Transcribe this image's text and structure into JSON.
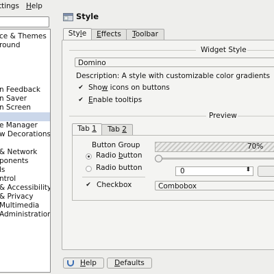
{
  "menubar": {
    "settings_prefix": "ttings",
    "help_prefix": "",
    "help_accel": "H",
    "help_rest": "elp"
  },
  "sidebar": {
    "items": [
      "ce & Themes",
      "round",
      "n Feedback",
      "n Saver",
      "n Screen",
      "e Manager",
      "w Decorations",
      "& Network",
      "ponents",
      "ls",
      "ntrol",
      "& Accessibility",
      "& Privacy",
      "Multimedia",
      "Administration"
    ]
  },
  "page": {
    "title": "Style"
  },
  "tabs": {
    "style": {
      "pre": "Sty",
      "accel": "l",
      "post": "e"
    },
    "effects": {
      "pre": "",
      "accel": "E",
      "post": "ffects"
    },
    "toolbar": {
      "pre": "",
      "accel": "T",
      "post": "oolbar"
    }
  },
  "widget_style": {
    "label": "Widget Style",
    "selected": "Domino",
    "description": "Description: A style with customizable color gradients",
    "show_icons": {
      "pre": "Sho",
      "accel": "w",
      "post": " icons on buttons",
      "checked": true
    },
    "tooltips": {
      "pre": "",
      "accel": "E",
      "post": "nable tooltips",
      "checked": true
    }
  },
  "preview": {
    "label": "Preview",
    "tab1": {
      "pre": "Tab ",
      "accel": "1",
      "post": ""
    },
    "tab2": {
      "pre": "Tab ",
      "accel": "2",
      "post": ""
    },
    "button_group_label": "Button Group",
    "radio1": {
      "pre": "Radio ",
      "accel": "b",
      "post": "utton",
      "checked": true
    },
    "radio2": {
      "pre": "Radio button",
      "checked": false
    },
    "checkbox": {
      "label": "Checkbox",
      "checked": true
    },
    "progress": {
      "value": 70,
      "label": "70%"
    },
    "slider_value": 0,
    "spin_value": "0",
    "combo_value": "Combobox"
  },
  "bottom": {
    "help": {
      "pre": "",
      "accel": "H",
      "post": "elp"
    },
    "defaults": {
      "pre": "",
      "accel": "D",
      "post": "efaults"
    }
  },
  "colors": {
    "selection": "#cbd7ea",
    "panel": "#f4f4f2",
    "window": "#eeeeec"
  }
}
